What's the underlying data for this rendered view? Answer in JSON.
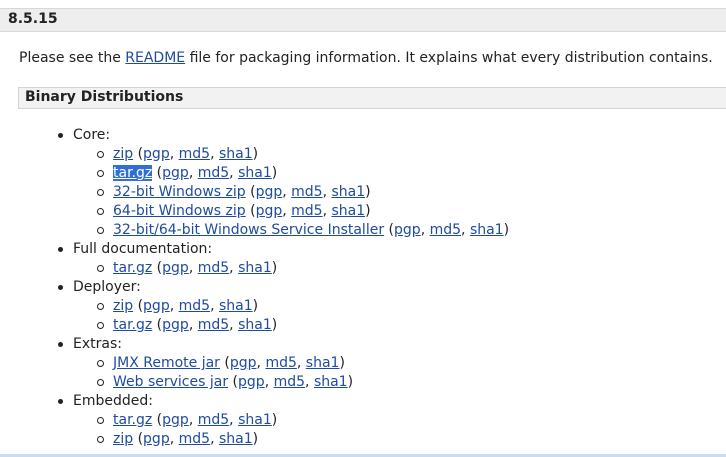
{
  "version": "8.5.15",
  "intro": {
    "before": "Please see the ",
    "link": "README",
    "after": " file for packaging information. It explains what every distribution contains."
  },
  "section_title": "Binary Distributions",
  "groups": [
    {
      "label": "Core:",
      "items": [
        {
          "main": "zip",
          "sigs": [
            "pgp",
            "md5",
            "sha1"
          ],
          "selected": false
        },
        {
          "main": "tar.gz",
          "sigs": [
            "pgp",
            "md5",
            "sha1"
          ],
          "selected": true
        },
        {
          "main": "32-bit Windows zip",
          "sigs": [
            "pgp",
            "md5",
            "sha1"
          ],
          "selected": false
        },
        {
          "main": "64-bit Windows zip",
          "sigs": [
            "pgp",
            "md5",
            "sha1"
          ],
          "selected": false
        },
        {
          "main": "32-bit/64-bit Windows Service Installer",
          "sigs": [
            "pgp",
            "md5",
            "sha1"
          ],
          "selected": false
        }
      ]
    },
    {
      "label": "Full documentation:",
      "items": [
        {
          "main": "tar.gz",
          "sigs": [
            "pgp",
            "md5",
            "sha1"
          ],
          "selected": false
        }
      ]
    },
    {
      "label": "Deployer:",
      "items": [
        {
          "main": "zip",
          "sigs": [
            "pgp",
            "md5",
            "sha1"
          ],
          "selected": false
        },
        {
          "main": "tar.gz",
          "sigs": [
            "pgp",
            "md5",
            "sha1"
          ],
          "selected": false
        }
      ]
    },
    {
      "label": "Extras:",
      "items": [
        {
          "main": "JMX Remote jar",
          "sigs": [
            "pgp",
            "md5",
            "sha1"
          ],
          "selected": false
        },
        {
          "main": "Web services jar",
          "sigs": [
            "pgp",
            "md5",
            "sha1"
          ],
          "selected": false
        }
      ]
    },
    {
      "label": "Embedded:",
      "items": [
        {
          "main": "tar.gz",
          "sigs": [
            "pgp",
            "md5",
            "sha1"
          ],
          "selected": false
        },
        {
          "main": "zip",
          "sigs": [
            "pgp",
            "md5",
            "sha1"
          ],
          "selected": false
        }
      ]
    }
  ],
  "colors": {
    "link": "#1f4ba0",
    "selection": "#2f6fd6",
    "header_bg": "#eeeeee"
  }
}
